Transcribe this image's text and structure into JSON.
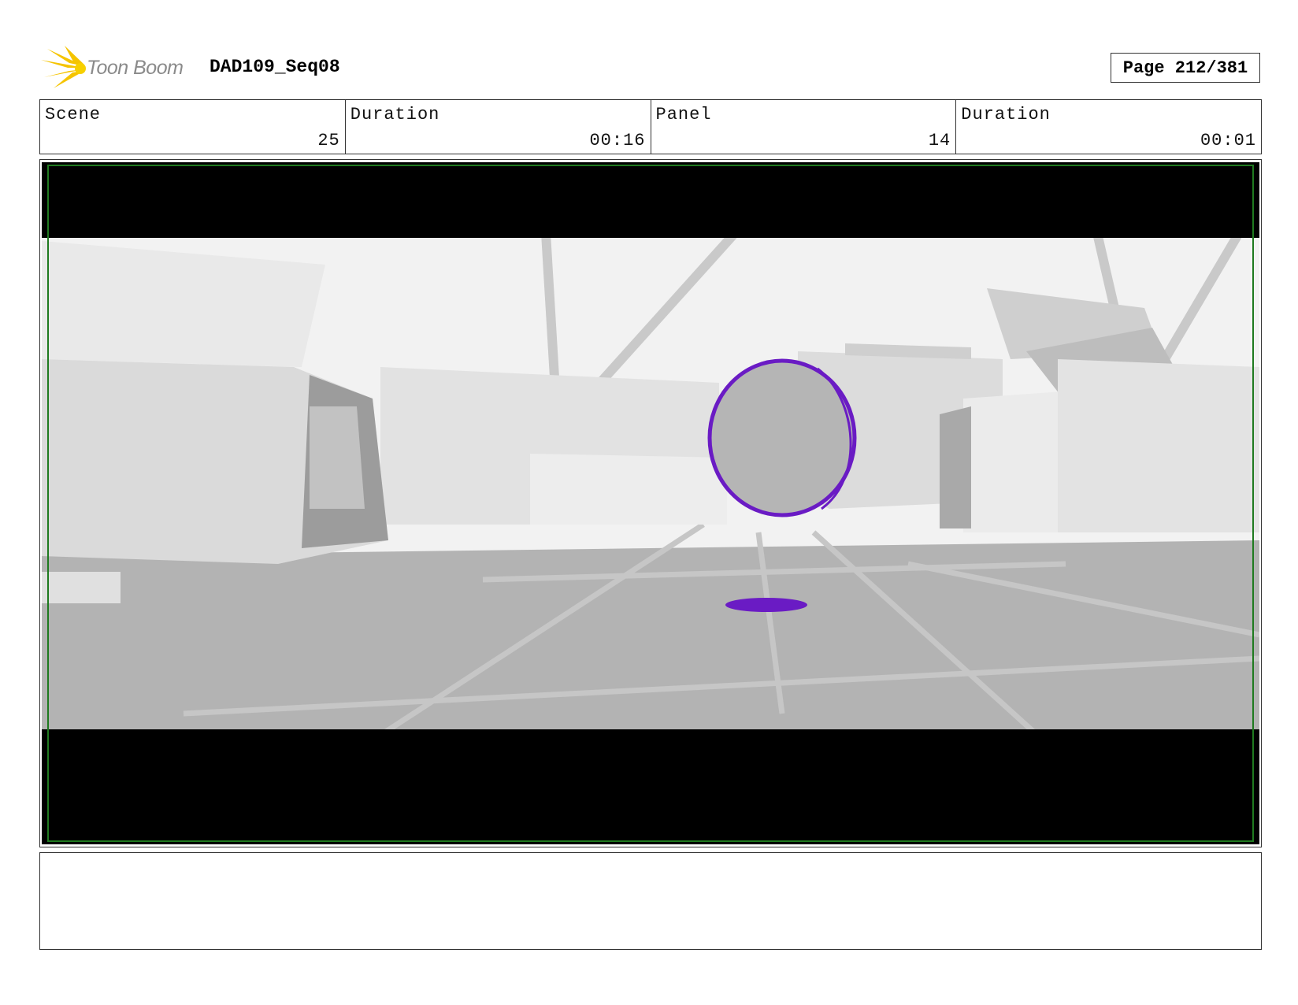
{
  "header": {
    "logo_text": "Toon Boom",
    "project": "DAD109_Seq08",
    "page": "Page 212/381"
  },
  "info": {
    "scene_label": "Scene",
    "scene_value": "25",
    "scene_duration_label": "Duration",
    "scene_duration_value": "00:16",
    "panel_label": "Panel",
    "panel_value": "14",
    "panel_duration_label": "Duration",
    "panel_duration_value": "00:01"
  },
  "colors": {
    "accent_purple": "#6a1bc4",
    "logo_yellow": "#f5c400",
    "frame_green": "#1f7a1f"
  },
  "notes": {
    "text": ""
  }
}
